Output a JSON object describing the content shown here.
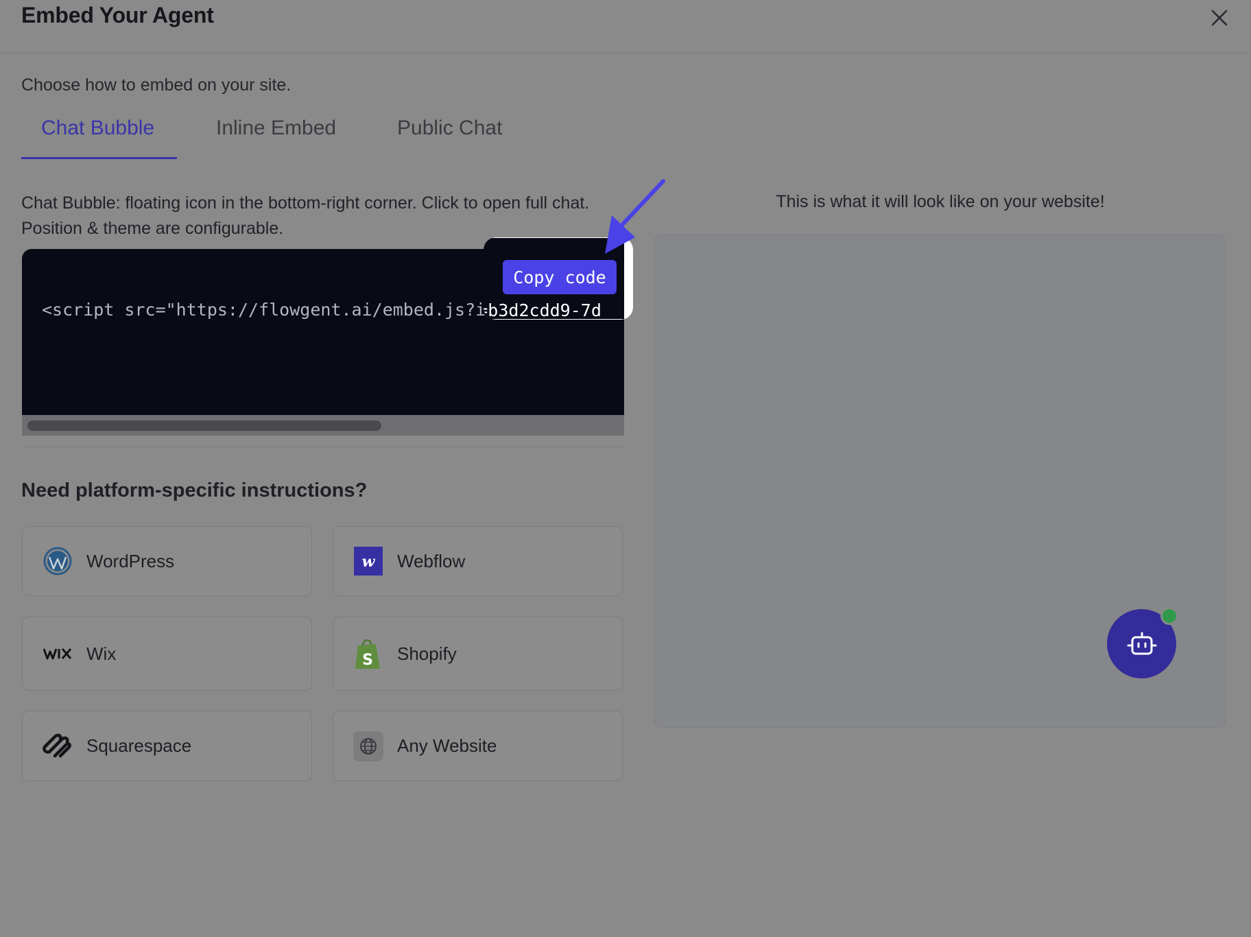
{
  "header": {
    "title": "Embed Your Agent"
  },
  "subtitle": "Choose how to embed on your site.",
  "tabs": [
    {
      "label": "Chat Bubble",
      "active": true
    },
    {
      "label": "Inline Embed",
      "active": false
    },
    {
      "label": "Public Chat",
      "active": false
    }
  ],
  "description": "Chat Bubble: floating icon in the bottom-right corner. Click to open full chat. Position & theme are configurable.",
  "code": {
    "snippet": "<script src=\"https://flowgent.ai/embed.js?id=b3d2cdd9-7d",
    "copy_label": "Copy code"
  },
  "platforms": {
    "title": "Need platform-specific instructions?",
    "items": [
      {
        "label": "WordPress",
        "icon": "wordpress-icon"
      },
      {
        "label": "Webflow",
        "icon": "webflow-icon"
      },
      {
        "label": "Wix",
        "icon": "wix-icon"
      },
      {
        "label": "Shopify",
        "icon": "shopify-icon"
      },
      {
        "label": "Squarespace",
        "icon": "squarespace-icon"
      },
      {
        "label": "Any Website",
        "icon": "globe-icon"
      }
    ]
  },
  "preview": {
    "caption": "This is what it will look like on your website!"
  },
  "colors": {
    "accent": "#4a42e6",
    "tab_active": "#3a35a8",
    "bubble": "#332c9a",
    "online_dot": "#2f9b4a",
    "code_bg": "#080b16"
  }
}
